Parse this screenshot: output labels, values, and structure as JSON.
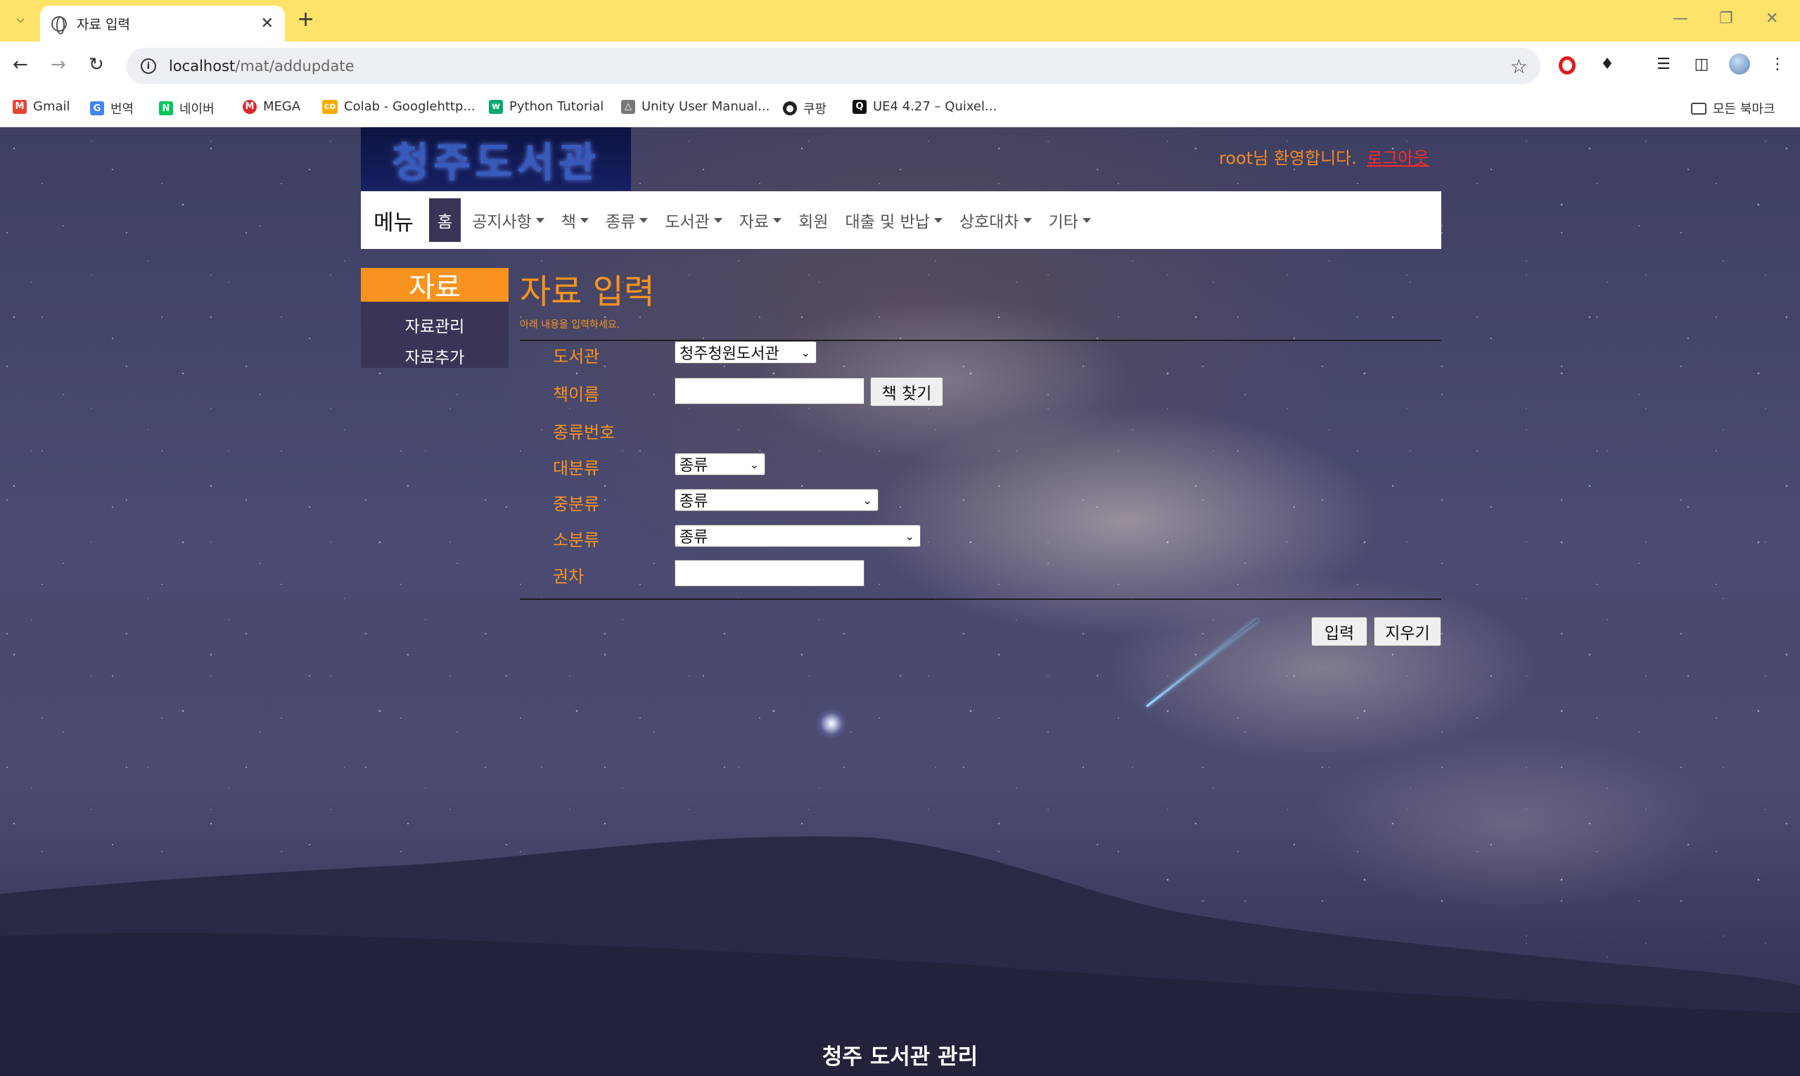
{
  "browser": {
    "tab_title": "자료 입력",
    "url_host": "localhost",
    "url_path": "/mat/addupdate",
    "bookmarks": [
      {
        "label": "Gmail",
        "icon": "gmail-icon",
        "color": "#ea4335"
      },
      {
        "label": "번역",
        "icon": "translate-icon",
        "color": "#4285f4"
      },
      {
        "label": "네이버",
        "icon": "naver-icon",
        "color": "#03c75a"
      },
      {
        "label": "MEGA",
        "icon": "mega-icon",
        "color": "#d9272e"
      },
      {
        "label": "Colab - Googlehttp...",
        "icon": "colab-icon",
        "color": "#f9ab00"
      },
      {
        "label": "Python Tutorial",
        "icon": "w3schools-icon",
        "color": "#04aa6d"
      },
      {
        "label": "Unity User Manual...",
        "icon": "unity-icon",
        "color": "#777777"
      },
      {
        "label": "쿠팡",
        "icon": "globe-icon",
        "color": "#222222"
      },
      {
        "label": "UE4 4.27 – Quixel...",
        "icon": "quixel-icon",
        "color": "#111111"
      }
    ],
    "all_bookmarks": "모든 북마크"
  },
  "site": {
    "logo_text": "청주도서관",
    "welcome": "root님 환영합니다.",
    "logout": "로그아웃",
    "nav": {
      "brand": "메뉴",
      "items": [
        "홈",
        "공지사항",
        "책",
        "종류",
        "도서관",
        "자료",
        "회원",
        "대출 및 반납",
        "상호대차",
        "기타"
      ]
    },
    "sidebar": {
      "title": "자료",
      "items": [
        "자료관리",
        "자료추가"
      ]
    },
    "page": {
      "title": "자료 입력",
      "subtitle": "아래 내용을 입력하세요."
    },
    "form": {
      "library_label": "도서관",
      "library_value": "청주청원도서관",
      "book_name_label": "책이름",
      "book_name_value": "",
      "find_book_button": "책 찾기",
      "category_number_label": "종류번호",
      "major_label": "대분류",
      "major_value": "종류",
      "middle_label": "중분류",
      "middle_value": "종류",
      "minor_label": "소분류",
      "minor_value": "종류",
      "volume_label": "권차",
      "volume_value": "",
      "submit_button": "입력",
      "clear_button": "지우기"
    },
    "footer": "청주 도서관 관리"
  }
}
